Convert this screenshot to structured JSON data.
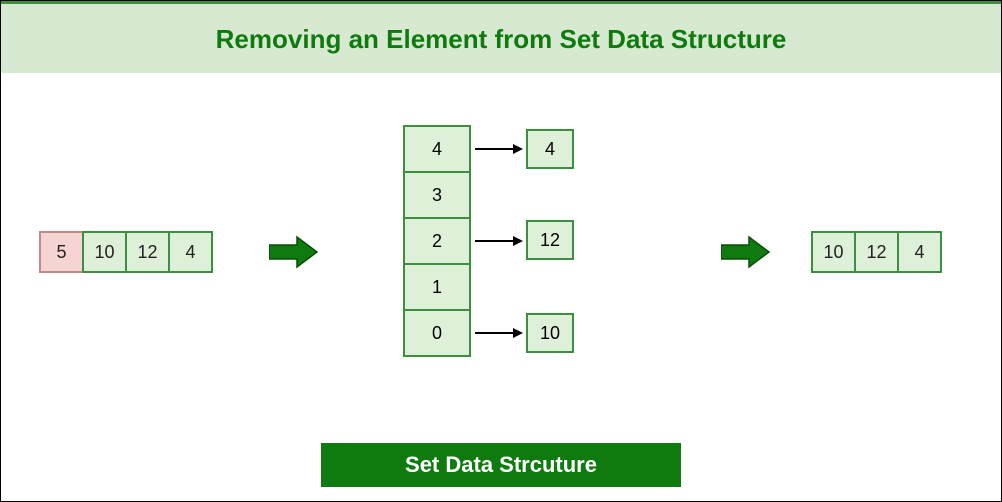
{
  "header": {
    "title": "Removing an Element from Set Data Structure"
  },
  "input_array": {
    "cells": [
      {
        "value": "5",
        "removed": true
      },
      {
        "value": "10",
        "removed": false
      },
      {
        "value": "12",
        "removed": false
      },
      {
        "value": "4",
        "removed": false
      }
    ]
  },
  "hash_table": {
    "buckets": [
      "4",
      "3",
      "2",
      "1",
      "0"
    ],
    "links": {
      "4": "4",
      "2": "12",
      "0": "10"
    }
  },
  "output_array": {
    "cells": [
      "10",
      "12",
      "4"
    ]
  },
  "footer": {
    "label": "Set Data Strcuture"
  },
  "colors": {
    "accent": "#0f7b0f",
    "cell_bg": "#dff0d8",
    "removed_bg": "#f6d4d4"
  }
}
